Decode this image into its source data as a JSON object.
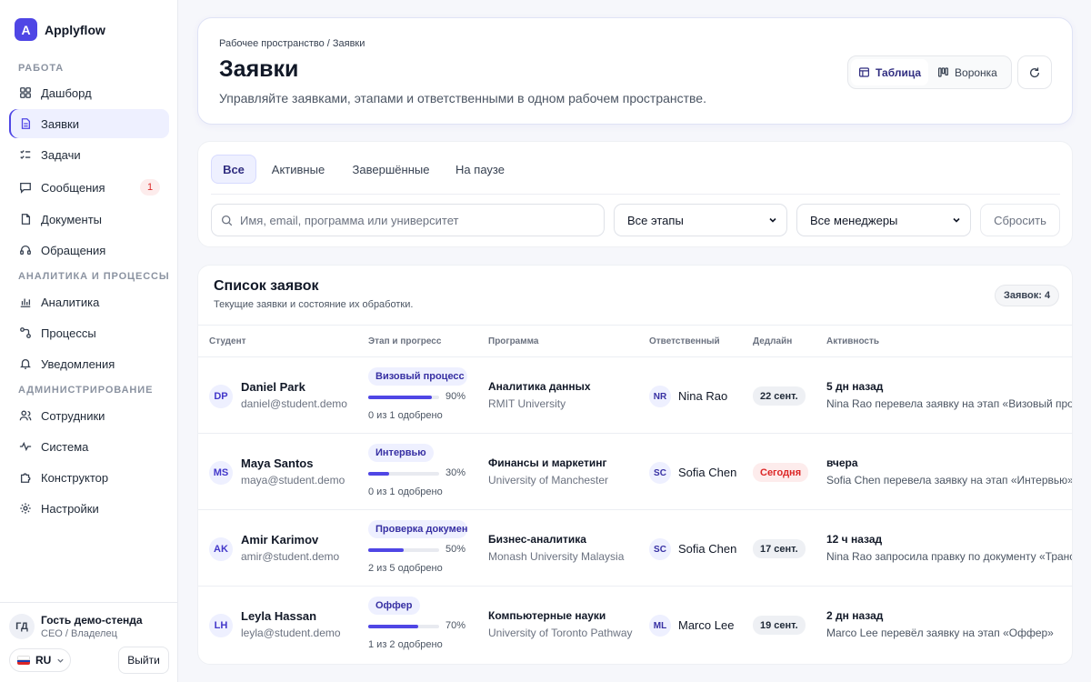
{
  "brand": {
    "logo_letter": "A",
    "name": "Applyflow",
    "accent": "#4f46e5"
  },
  "sidebar": {
    "sections": [
      {
        "title": "РАБОТА"
      },
      {
        "title": "АНАЛИТИКА И ПРОЦЕССЫ"
      },
      {
        "title": "АДМИНИСТРИРОВАНИЕ"
      }
    ],
    "items": [
      {
        "label": "Дашборд",
        "icon": "grid-icon"
      },
      {
        "label": "Заявки",
        "icon": "document-icon",
        "active": true
      },
      {
        "label": "Задачи",
        "icon": "checklist-icon"
      },
      {
        "label": "Сообщения",
        "icon": "chat-icon",
        "badge": "1"
      },
      {
        "label": "Документы",
        "icon": "file-icon"
      },
      {
        "label": "Обращения",
        "icon": "headset-icon"
      },
      {
        "label": "Аналитика",
        "icon": "bar-chart-icon"
      },
      {
        "label": "Процессы",
        "icon": "workflow-icon"
      },
      {
        "label": "Уведомления",
        "icon": "bell-icon"
      },
      {
        "label": "Сотрудники",
        "icon": "users-icon"
      },
      {
        "label": "Система",
        "icon": "activity-icon"
      },
      {
        "label": "Конструктор",
        "icon": "puzzle-icon"
      },
      {
        "label": "Настройки",
        "icon": "settings-icon"
      }
    ],
    "user": {
      "initials": "ГД",
      "name": "Гость демо-стенда",
      "role": "CEO / Владелец"
    },
    "lang": "RU",
    "logout_label": "Выйти"
  },
  "header": {
    "breadcrumb": "Рабочее пространство / Заявки",
    "title": "Заявки",
    "description": "Управляйте заявками, этапами и ответственными в одном рабочем пространстве.",
    "view_table": "Таблица",
    "view_funnel": "Воронка"
  },
  "filters": {
    "tabs": [
      "Все",
      "Активные",
      "Завершённые",
      "На паузе"
    ],
    "search_placeholder": "Имя, email, программа или университет",
    "stage_select": "Все этапы",
    "manager_select": "Все менеджеры",
    "reset_label": "Сбросить"
  },
  "list": {
    "title": "Список заявок",
    "subtitle": "Текущие заявки и состояние их обработки.",
    "count_badge": "Заявок: 4",
    "columns": [
      "Студент",
      "Этап и прогресс",
      "Программа",
      "Ответственный",
      "Дедлайн",
      "Активность"
    ],
    "rows": [
      {
        "initials": "DP",
        "name": "Daniel Park",
        "email": "daniel@student.demo",
        "stage": "Визовый процесс",
        "progress": 90,
        "progress_label": "90%",
        "approved": "0 из 1 одобрено",
        "program": "Аналитика данных",
        "university": "RMIT University",
        "manager_initials": "NR",
        "manager": "Nina Rao",
        "deadline": "22 сент.",
        "deadline_urgent": false,
        "activity_when": "5 дн назад",
        "activity": "Nina Rao перевела заявку на этап «Визовый процесс»"
      },
      {
        "initials": "MS",
        "name": "Maya Santos",
        "email": "maya@student.demo",
        "stage": "Интервью",
        "progress": 30,
        "progress_label": "30%",
        "approved": "0 из 1 одобрено",
        "program": "Финансы и маркетинг",
        "university": "University of Manchester",
        "manager_initials": "SC",
        "manager": "Sofia Chen",
        "deadline": "Сегодня",
        "deadline_urgent": true,
        "activity_when": "вчера",
        "activity": "Sofia Chen перевела заявку на этап «Интервью»"
      },
      {
        "initials": "AK",
        "name": "Amir Karimov",
        "email": "amir@student.demo",
        "stage": "Проверка документов",
        "progress": 50,
        "progress_label": "50%",
        "approved": "2 из 5 одобрено",
        "program": "Бизнес-аналитика",
        "university": "Monash University Malaysia",
        "manager_initials": "SC",
        "manager": "Sofia Chen",
        "deadline": "17 сент.",
        "deadline_urgent": false,
        "activity_when": "12 ч назад",
        "activity": "Nina Rao запросила правку по документу «Транскрипт»"
      },
      {
        "initials": "LH",
        "name": "Leyla Hassan",
        "email": "leyla@student.demo",
        "stage": "Оффер",
        "progress": 70,
        "progress_label": "70%",
        "approved": "1 из 2 одобрено",
        "program": "Компьютерные науки",
        "university": "University of Toronto Pathway",
        "manager_initials": "ML",
        "manager": "Marco Lee",
        "deadline": "19 сент.",
        "deadline_urgent": false,
        "activity_when": "2 дн назад",
        "activity": "Marco Lee перевёл заявку на этап «Оффер»"
      }
    ]
  }
}
